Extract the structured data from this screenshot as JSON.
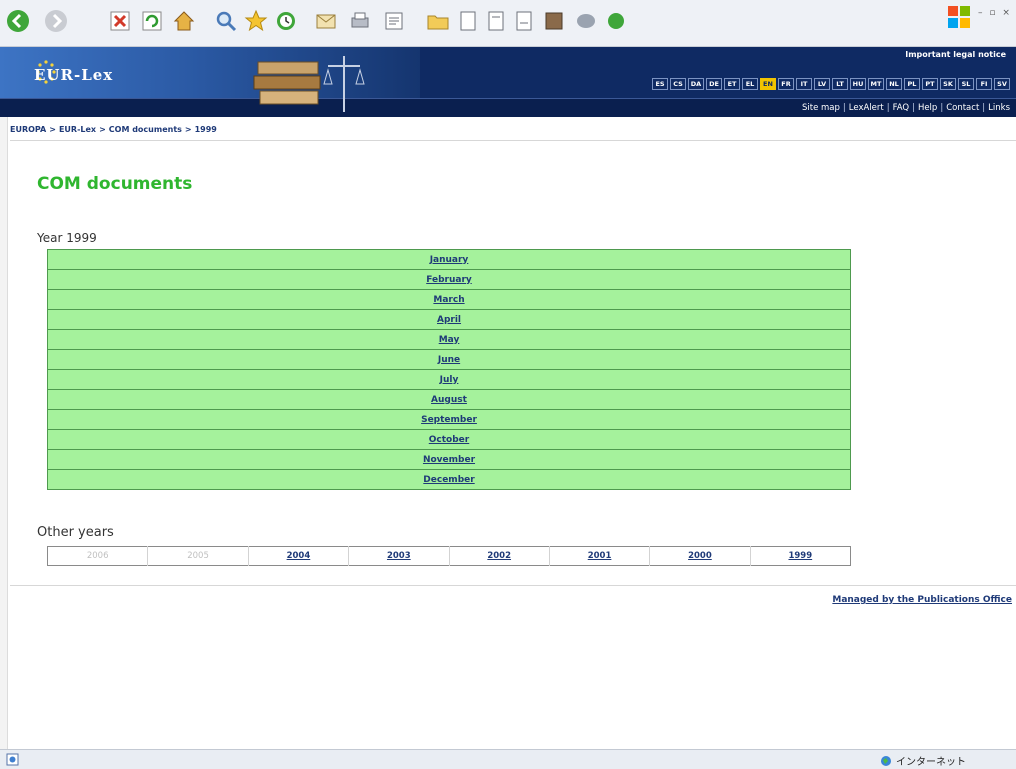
{
  "header": {
    "logo_text": "EUR-Lex",
    "legal_notice": "Important legal notice",
    "languages": [
      "ES",
      "CS",
      "DA",
      "DE",
      "ET",
      "EL",
      "EN",
      "FR",
      "IT",
      "LV",
      "LT",
      "HU",
      "MT",
      "NL",
      "PL",
      "PT",
      "SK",
      "SL",
      "FI",
      "SV"
    ],
    "active_language": "EN",
    "util_links": [
      "Site map",
      "LexAlert",
      "FAQ",
      "Help",
      "Contact",
      "Links"
    ],
    "util_separator": "|"
  },
  "breadcrumb": {
    "items": [
      "EUROPA",
      "EUR-Lex",
      "COM documents",
      "1999"
    ],
    "separator": ">"
  },
  "main": {
    "title": "COM documents",
    "year_label": "Year 1999",
    "months": [
      "January",
      "February",
      "March",
      "April",
      "May",
      "June",
      "July",
      "August",
      "September",
      "October",
      "November",
      "December"
    ],
    "other_years_label": "Other years",
    "years": [
      {
        "label": "2006",
        "enabled": false
      },
      {
        "label": "2005",
        "enabled": false
      },
      {
        "label": "2004",
        "enabled": true
      },
      {
        "label": "2003",
        "enabled": true
      },
      {
        "label": "2002",
        "enabled": true
      },
      {
        "label": "2001",
        "enabled": true
      },
      {
        "label": "2000",
        "enabled": true
      },
      {
        "label": "1999",
        "enabled": true
      }
    ]
  },
  "footer": {
    "managed_by": "Managed by the Publications Office"
  },
  "statusbar": {
    "zone": "インターネット"
  },
  "colors": {
    "header_navy": "#0f2a63",
    "title_green": "#2fb62f",
    "month_cell_green": "#a5f29c",
    "link_blue": "#1f3a78",
    "active_language": "#f2c400"
  },
  "icons": [
    "back-icon",
    "forward-icon",
    "stop-icon",
    "refresh-icon",
    "home-icon",
    "search-icon",
    "favorites-icon",
    "history-icon",
    "mail-icon",
    "print-icon",
    "edit-icon",
    "folder-icon",
    "windows-flag-icon",
    "globe-icon",
    "page-icon"
  ]
}
